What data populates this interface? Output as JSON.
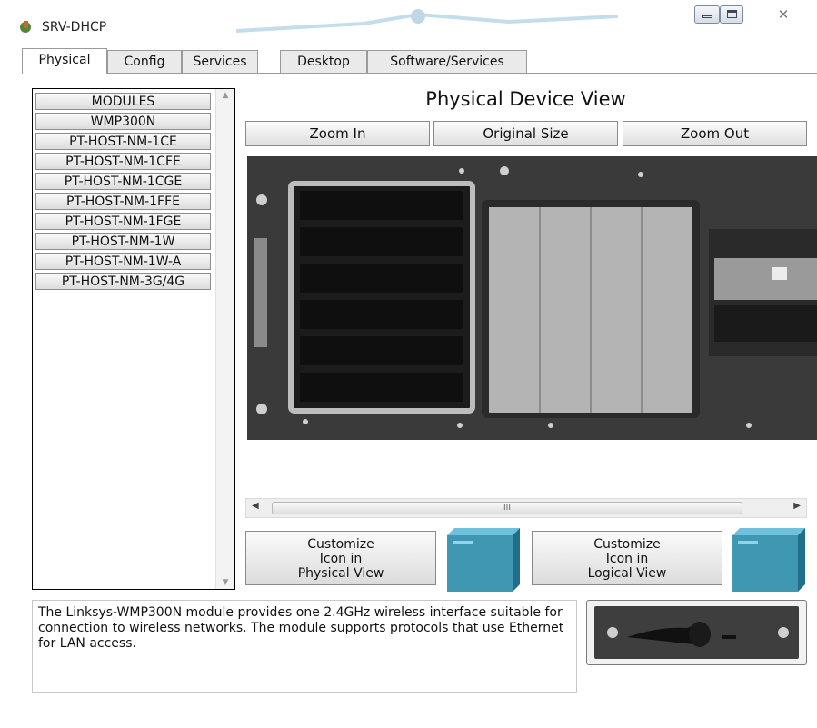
{
  "window": {
    "title": "SRV-DHCP",
    "close_glyph": "✕"
  },
  "tabs": [
    {
      "label": "Physical",
      "active": true
    },
    {
      "label": "Config",
      "active": false
    },
    {
      "label": "Services",
      "active": false
    },
    {
      "label": "Desktop",
      "active": false
    },
    {
      "label": "Software/Services",
      "active": false
    }
  ],
  "modules": {
    "items": [
      "MODULES",
      "WMP300N",
      "PT-HOST-NM-1CE",
      "PT-HOST-NM-1CFE",
      "PT-HOST-NM-1CGE",
      "PT-HOST-NM-1FFE",
      "PT-HOST-NM-1FGE",
      "PT-HOST-NM-1W",
      "PT-HOST-NM-1W-A",
      "PT-HOST-NM-3G/4G"
    ]
  },
  "physical_view": {
    "title": "Physical Device View",
    "zoom_in": "Zoom In",
    "original_size": "Original Size",
    "zoom_out": "Zoom Out",
    "scroll_grip": "III"
  },
  "customize": {
    "physical": [
      "Customize",
      "Icon in",
      "Physical View"
    ],
    "logical": [
      "Customize",
      "Icon in",
      "Logical View"
    ]
  },
  "description": "The Linksys-WMP300N module provides one 2.4GHz wireless interface suitable for connection to wireless networks. The module supports protocols that use Ethernet for LAN access.",
  "colors": {
    "device_body": "#3c3c3c",
    "cube_face": "#3f97b2"
  }
}
